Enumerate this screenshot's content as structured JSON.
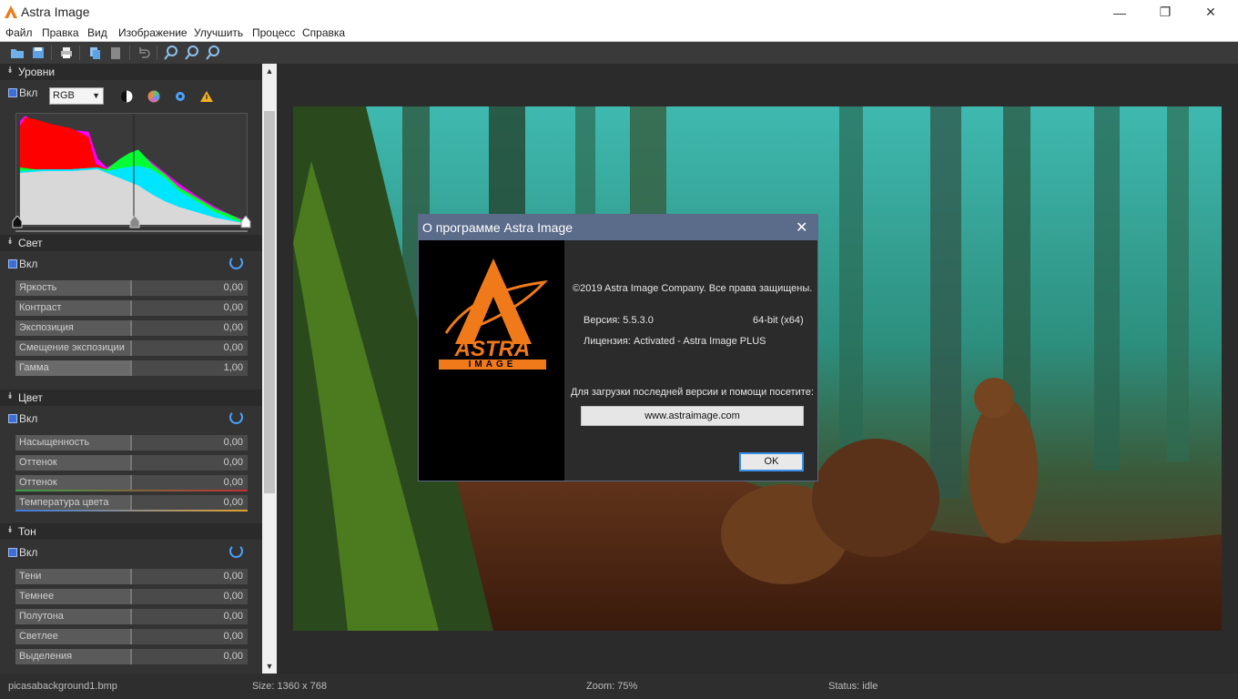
{
  "window": {
    "title": "Astra Image",
    "minimize": "—",
    "maximize": "❐",
    "close": "✕"
  },
  "menu": [
    "Файл",
    "Правка",
    "Вид",
    "Изображение",
    "Улучшить",
    "Процесс",
    "Справка"
  ],
  "toolbar": {
    "icons": [
      "open-icon",
      "save-icon",
      "print-icon",
      "copy-icon",
      "paste-icon",
      "undo-icon",
      "zoom-in-icon",
      "zoom-out-icon",
      "zoom-fit-icon"
    ]
  },
  "panel": {
    "levels": {
      "title": "Уровни",
      "enable_label": "Вкл",
      "channel": "RGB",
      "icons": [
        "contrast-icon",
        "color-wheel-icon",
        "gear-icon",
        "warning-icon",
        "reset-icon"
      ]
    },
    "light": {
      "title": "Свет",
      "enable_label": "Вкл",
      "sliders": [
        {
          "name": "Яркость",
          "value": "0,00"
        },
        {
          "name": "Контраст",
          "value": "0,00"
        },
        {
          "name": "Экспозиция",
          "value": "0,00"
        },
        {
          "name": "Смещение экспозиции",
          "value": "0,00"
        },
        {
          "name": "Гамма",
          "value": "1,00"
        }
      ]
    },
    "color": {
      "title": "Цвет",
      "enable_label": "Вкл",
      "sliders": [
        {
          "name": "Насыщенность",
          "value": "0,00"
        },
        {
          "name": "Оттенок",
          "value": "0,00"
        },
        {
          "name": "Оттенок",
          "value": "0,00"
        },
        {
          "name": "Температура цвета",
          "value": "0,00"
        }
      ]
    },
    "tone": {
      "title": "Тон",
      "enable_label": "Вкл",
      "sliders": [
        {
          "name": "Тени",
          "value": "0,00"
        },
        {
          "name": "Темнее",
          "value": "0,00"
        },
        {
          "name": "Полутона",
          "value": "0,00"
        },
        {
          "name": "Светлее",
          "value": "0,00"
        },
        {
          "name": "Выделения",
          "value": "0,00"
        }
      ]
    }
  },
  "status": {
    "file": "picasabackground1.bmp",
    "size": "Size: 1360 x 768",
    "zoom": "Zoom: 75%",
    "state": "Status: idle"
  },
  "dialog": {
    "title": "О программе Astra Image",
    "copyright": "©2019 Astra Image Company. Все права защищены.",
    "version_label": "Версия: 5.5.3.0",
    "arch": "64-bit (x64)",
    "license": "Лицензия:   Activated - Astra Image PLUS",
    "download_text": "Для загрузки последней версии и помощи посетите:",
    "link": "www.astraimage.com",
    "ok": "OK",
    "logo_text": "ASTRA",
    "logo_sub": "IMAGE"
  }
}
